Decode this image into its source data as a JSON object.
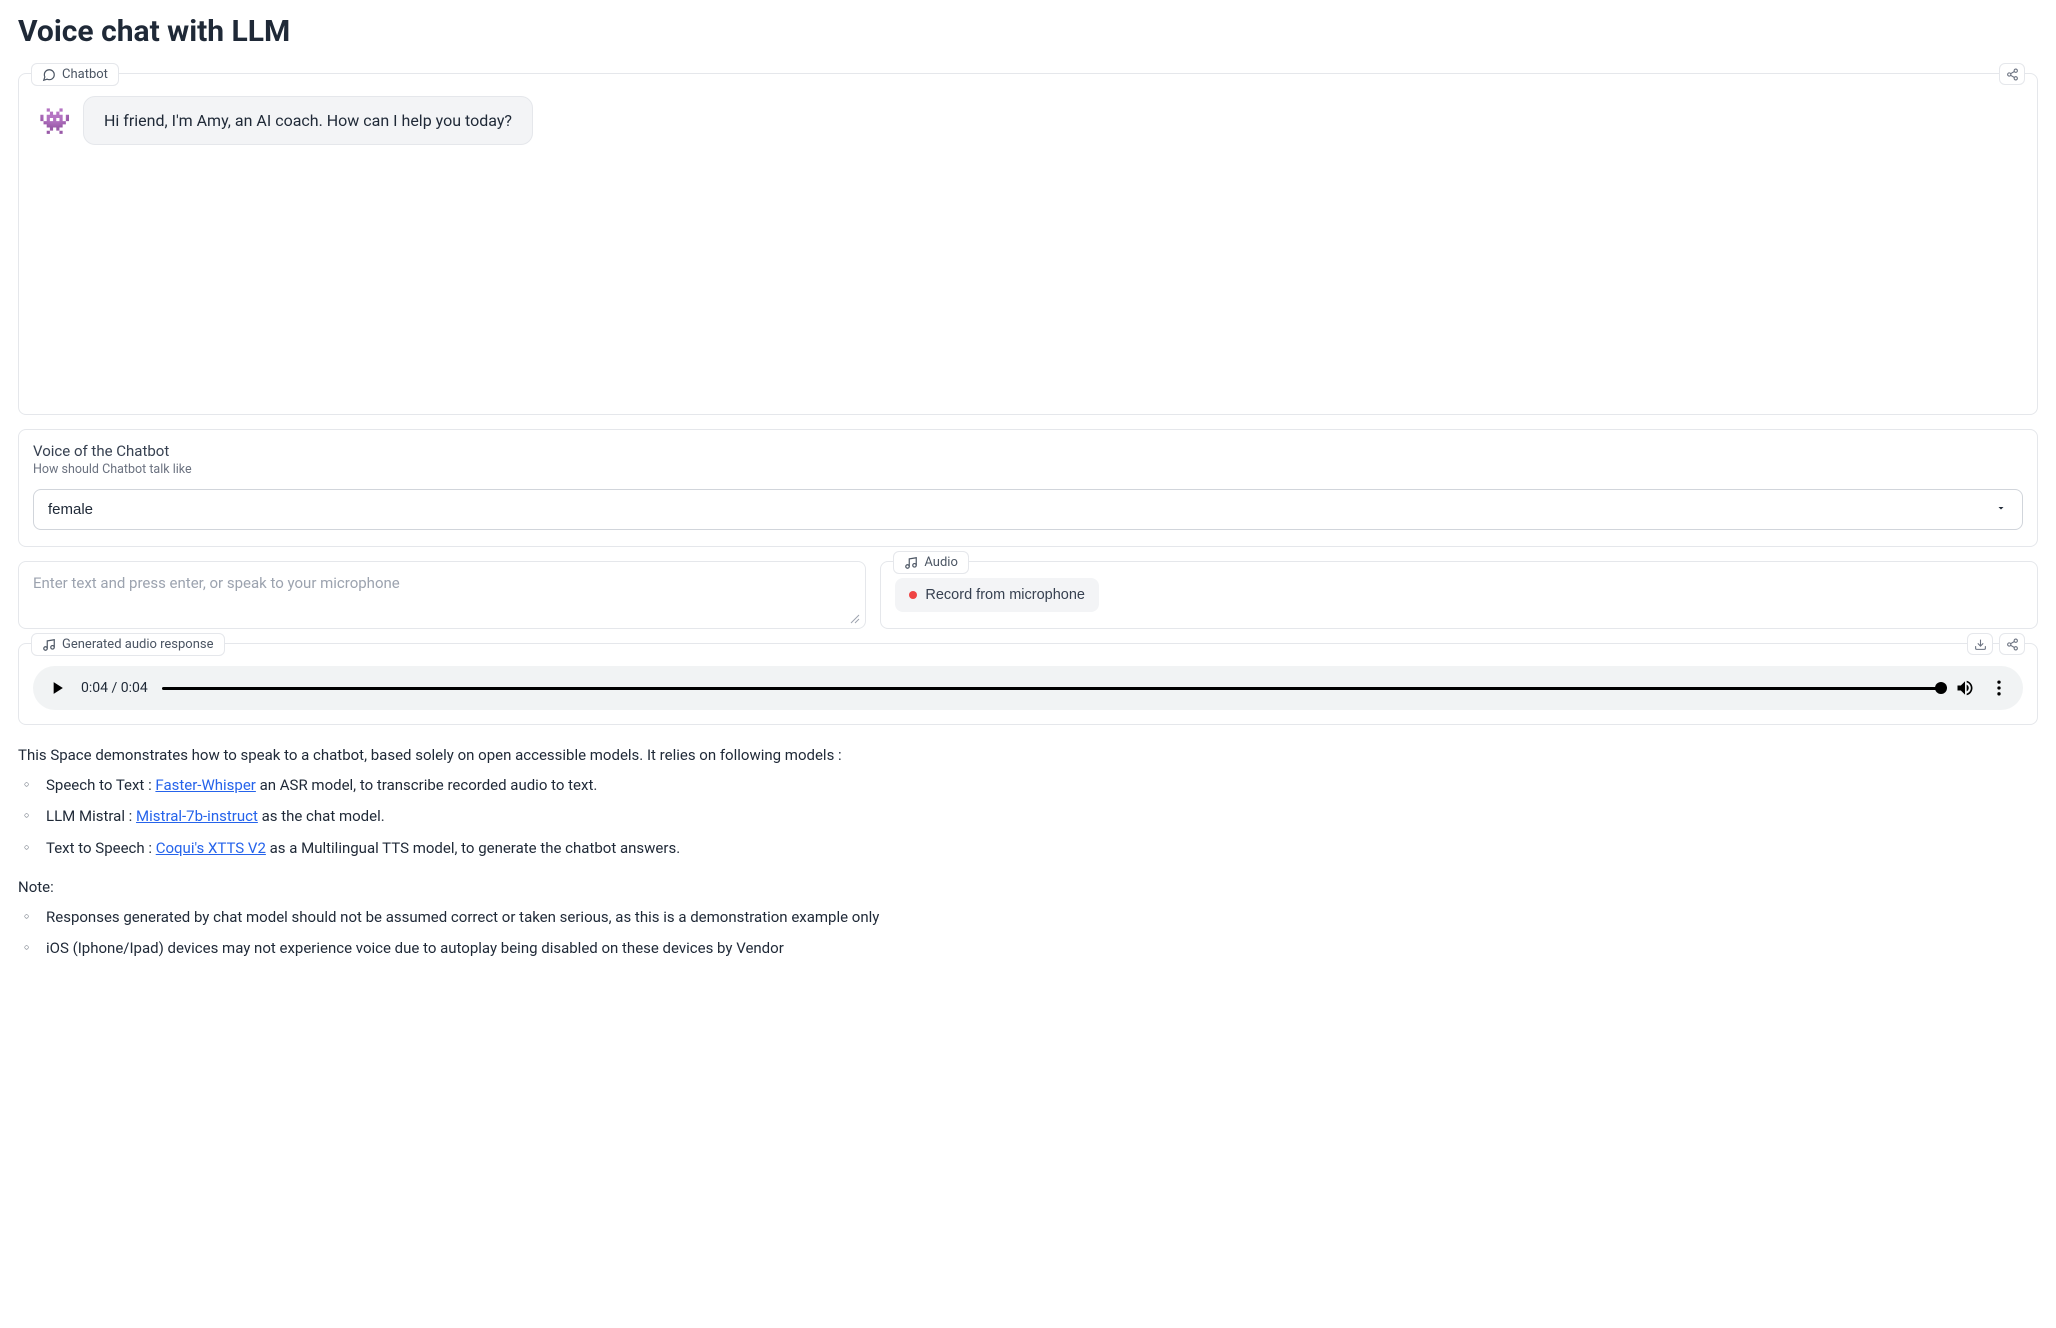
{
  "page": {
    "title": "Voice chat with LLM"
  },
  "chatbot": {
    "label": "Chatbot",
    "avatar_icon": "alien-monster-icon",
    "message": "Hi friend, I'm Amy, an AI coach. How can I help you today?"
  },
  "voice": {
    "title": "Voice of the Chatbot",
    "subtitle": "How should Chatbot talk like",
    "selected": "female"
  },
  "text_input": {
    "placeholder": "Enter text and press enter, or speak to your microphone"
  },
  "audio_input": {
    "label": "Audio",
    "record_label": "Record from microphone"
  },
  "audio_output": {
    "label": "Generated audio response",
    "current_time": "0:04",
    "total_time": "0:04"
  },
  "description": {
    "intro": "This Space demonstrates how to speak to a chatbot, based solely on open accessible models. It relies on following models :",
    "items": [
      {
        "prefix": "Speech to Text : ",
        "link": "Faster-Whisper",
        "suffix": " an ASR model, to transcribe recorded audio to text."
      },
      {
        "prefix": "LLM Mistral : ",
        "link": "Mistral-7b-instruct",
        "suffix": " as the chat model."
      },
      {
        "prefix": "Text to Speech : ",
        "link": "Coqui's XTTS V2",
        "suffix": " as a Multilingual TTS model, to generate the chatbot answers."
      }
    ],
    "note_title": "Note:",
    "notes": [
      "Responses generated by chat model should not be assumed correct or taken serious, as this is a demonstration example only",
      "iOS (Iphone/Ipad) devices may not experience voice due to autoplay being disabled on these devices by Vendor"
    ]
  }
}
